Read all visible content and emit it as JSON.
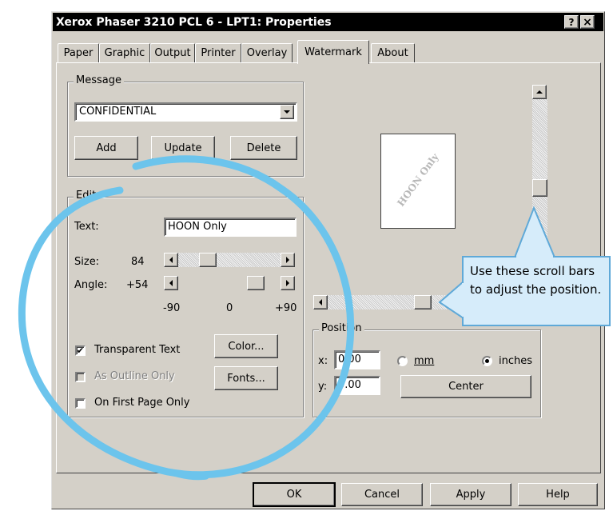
{
  "window": {
    "title": "Xerox Phaser 3210 PCL 6 - LPT1: Properties",
    "help_glyph": "?",
    "close_glyph": "×"
  },
  "tabs": [
    "Paper",
    "Graphic",
    "Output",
    "Printer",
    "Overlay",
    "Watermark",
    "About"
  ],
  "active_tab": "Watermark",
  "message": {
    "group_label": "Message",
    "selected": "CONFIDENTIAL",
    "add_label": "Add",
    "update_label": "Update",
    "delete_label": "Delete"
  },
  "edit": {
    "group_label": "Edit",
    "text_label": "Text:",
    "text_value": "HOON Only",
    "size_label": "Size:",
    "size_value": "84",
    "angle_label": "Angle:",
    "angle_value": "+54",
    "tick_min": "-90",
    "tick_mid": "0",
    "tick_max": "+90",
    "transparent_label": "Transparent Text",
    "transparent_checked": true,
    "outline_label": "As Outline Only",
    "outline_checked": false,
    "first_page_label": "On First Page Only",
    "first_page_checked": false,
    "color_label": "Color...",
    "fonts_label": "Fonts..."
  },
  "preview": {
    "watermark_text": "HOON Only",
    "watermark_angle": 54
  },
  "callout": {
    "text": "Use these scroll bars to adjust the position."
  },
  "position": {
    "group_label": "Position",
    "x_label": "x:",
    "x_value": "0.00",
    "y_label": "y:",
    "y_value": "0.00",
    "mm_label": "mm",
    "inches_label": "inches",
    "unit_selected": "inches",
    "center_label": "Center"
  },
  "footer": {
    "ok_label": "OK",
    "cancel_label": "Cancel",
    "apply_label": "Apply",
    "help_label": "Help"
  },
  "colors": {
    "title_bar": "#000000",
    "dialog_face": "#d4d0c8",
    "callout_fill": "#d6ecfa",
    "callout_border": "#5fa9d8",
    "annotation_circle": "#6cc4ec",
    "preview_text": "#b8b8b8"
  }
}
